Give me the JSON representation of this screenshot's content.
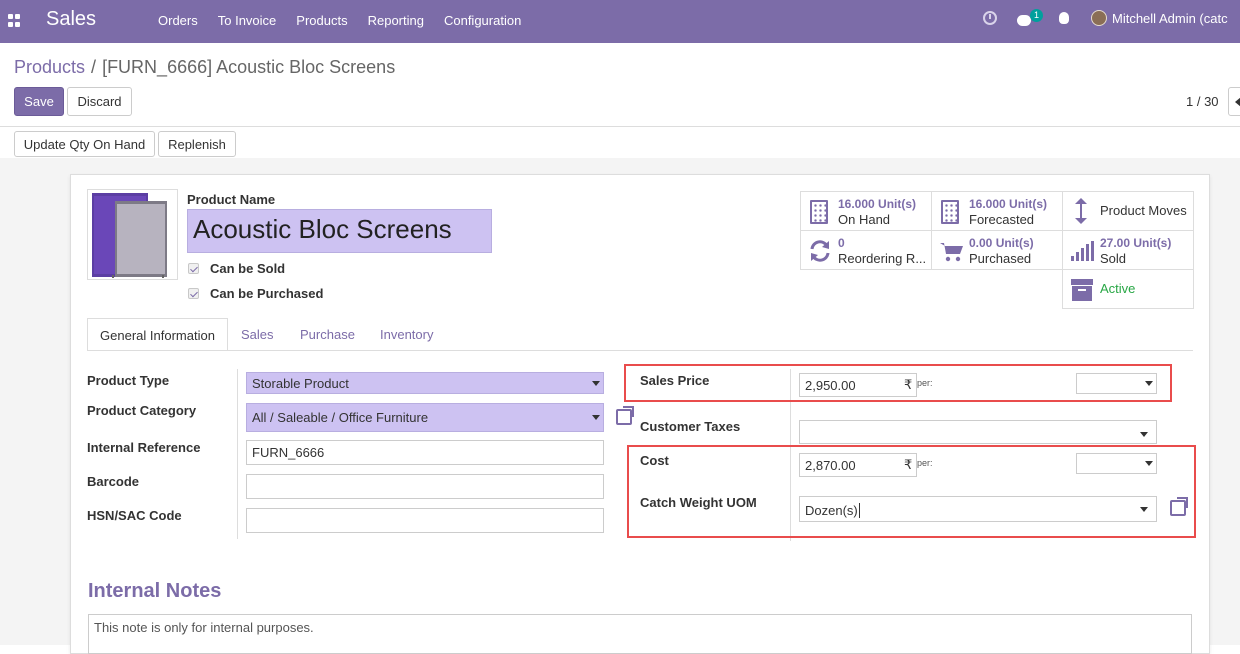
{
  "navbar": {
    "app_name": "Sales",
    "menu": [
      "Orders",
      "To Invoice",
      "Products",
      "Reporting",
      "Configuration"
    ],
    "message_count": "1",
    "user_name": "Mitchell Admin (catc"
  },
  "breadcrumb": {
    "parent": "Products",
    "separator": "/",
    "current": "[FURN_6666] Acoustic Bloc Screens"
  },
  "buttons": {
    "save": "Save",
    "discard": "Discard",
    "update_qty": "Update Qty On Hand",
    "replenish": "Replenish"
  },
  "pager": {
    "value": "1 / 30"
  },
  "product": {
    "name_label": "Product Name",
    "name": "Acoustic Bloc Screens",
    "can_be_sold_label": "Can be Sold",
    "can_be_purchased_label": "Can be Purchased",
    "can_be_sold": true,
    "can_be_purchased": true
  },
  "smart_buttons": {
    "on_hand": {
      "value": "16.000 Unit(s)",
      "label": "On Hand"
    },
    "forecasted": {
      "value": "16.000 Unit(s)",
      "label": "Forecasted"
    },
    "product_moves": {
      "label": "Product Moves"
    },
    "reordering": {
      "value": "0",
      "label": "Reordering R..."
    },
    "purchased": {
      "value": "0.00 Unit(s)",
      "label": "Purchased"
    },
    "sold": {
      "value": "27.00 Unit(s)",
      "label": "Sold"
    },
    "active": {
      "label": "Active"
    }
  },
  "tabs": [
    "General Information",
    "Sales",
    "Purchase",
    "Inventory"
  ],
  "general": {
    "product_type_label": "Product Type",
    "product_type": "Storable Product",
    "product_category_label": "Product Category",
    "product_category": "All / Saleable / Office Furniture",
    "internal_reference_label": "Internal Reference",
    "internal_reference": "FURN_6666",
    "barcode_label": "Barcode",
    "barcode": "",
    "hsn_label": "HSN/SAC Code",
    "hsn": ""
  },
  "pricing": {
    "sales_price_label": "Sales Price",
    "sales_price": "2,950.00",
    "currency_symbol": "₹",
    "per_label": "per:",
    "customer_taxes_label": "Customer Taxes",
    "cost_label": "Cost",
    "cost": "2,870.00",
    "catch_weight_uom_label": "Catch Weight UOM",
    "catch_weight_uom": "Dozen(s)"
  },
  "notes": {
    "title": "Internal Notes",
    "placeholder": "This note is only for internal purposes."
  },
  "colors": {
    "brand": "#7c6ca8",
    "required_field": "#cdc2f2",
    "highlight": "#e94c4c",
    "active_status": "#28a745"
  }
}
